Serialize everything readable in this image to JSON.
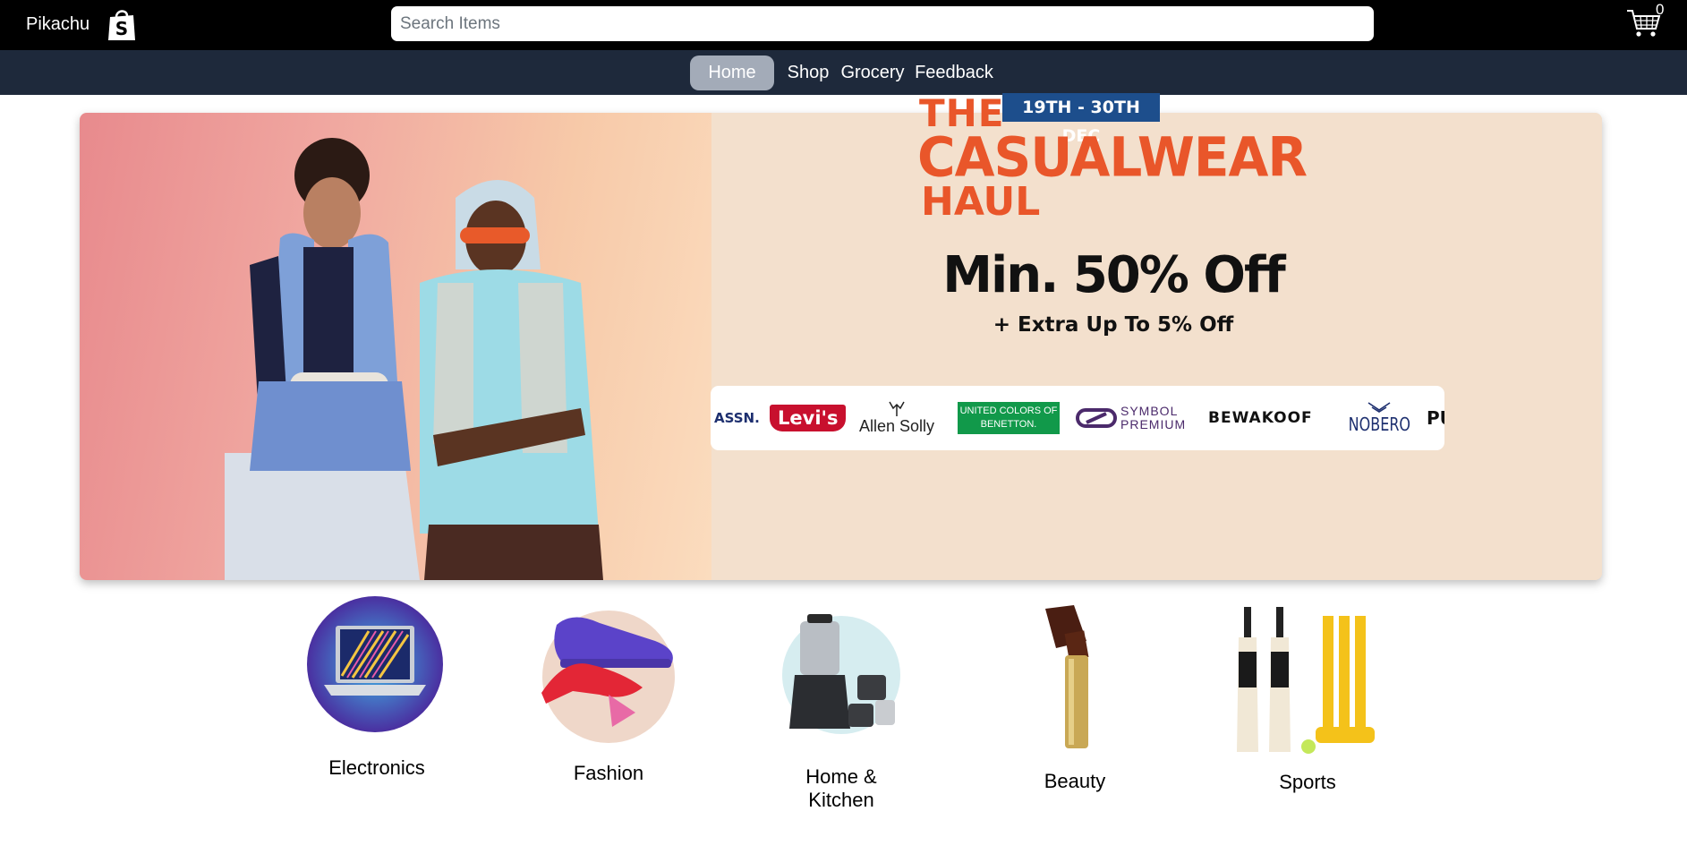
{
  "header": {
    "brand": "Pikachu",
    "search_placeholder": "Search Items",
    "cart_count": "0"
  },
  "nav": {
    "home": "Home",
    "shop": "Shop",
    "grocery": "Grocery",
    "feedback": "Feedback"
  },
  "banner": {
    "title_the": "THE",
    "dates": "19TH - 30TH DEC",
    "title_main": "CASUALWEAR",
    "title_haul": "HAUL",
    "offer": "Min. 50% Off",
    "offer_sub": "+ Extra Up To 5% Off",
    "brands": [
      "ASSN.",
      "Levi's",
      "Allen Solly",
      "UNITED COLORS OF BENETTON.",
      "SYMBOL PREMIUM",
      "BEWAKOOF",
      "NOBERO",
      "PU"
    ]
  },
  "categories": [
    {
      "label": "Electronics"
    },
    {
      "label": "Fashion"
    },
    {
      "label": "Home & Kitchen"
    },
    {
      "label": "Beauty"
    },
    {
      "label": "Sports"
    }
  ],
  "colors": {
    "topbar": "#000000",
    "navbar": "#1e293b",
    "nav_active": "#a3abb8",
    "banner_accent": "#e9562a",
    "banner_bg": "#f3e0cd"
  }
}
